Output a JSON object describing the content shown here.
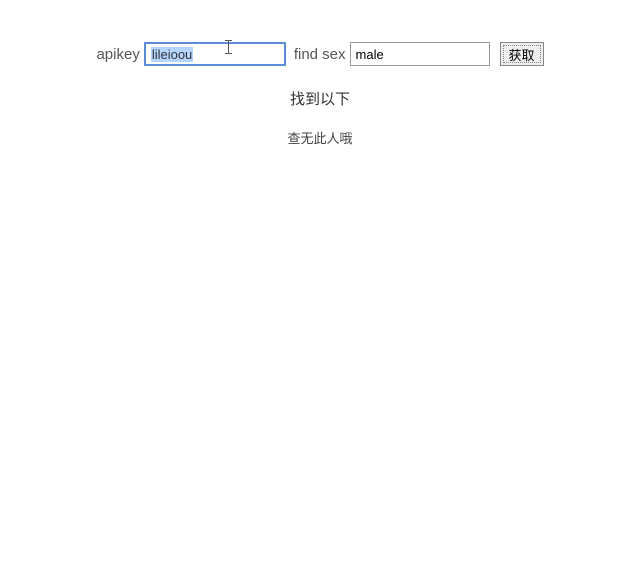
{
  "form": {
    "apikey_label": "apikey",
    "apikey_value": "lileioou",
    "findsex_label": "find sex",
    "findsex_value": "male",
    "fetch_button": "获取"
  },
  "results": {
    "header": "找到以下",
    "message": "查无此人哦"
  }
}
